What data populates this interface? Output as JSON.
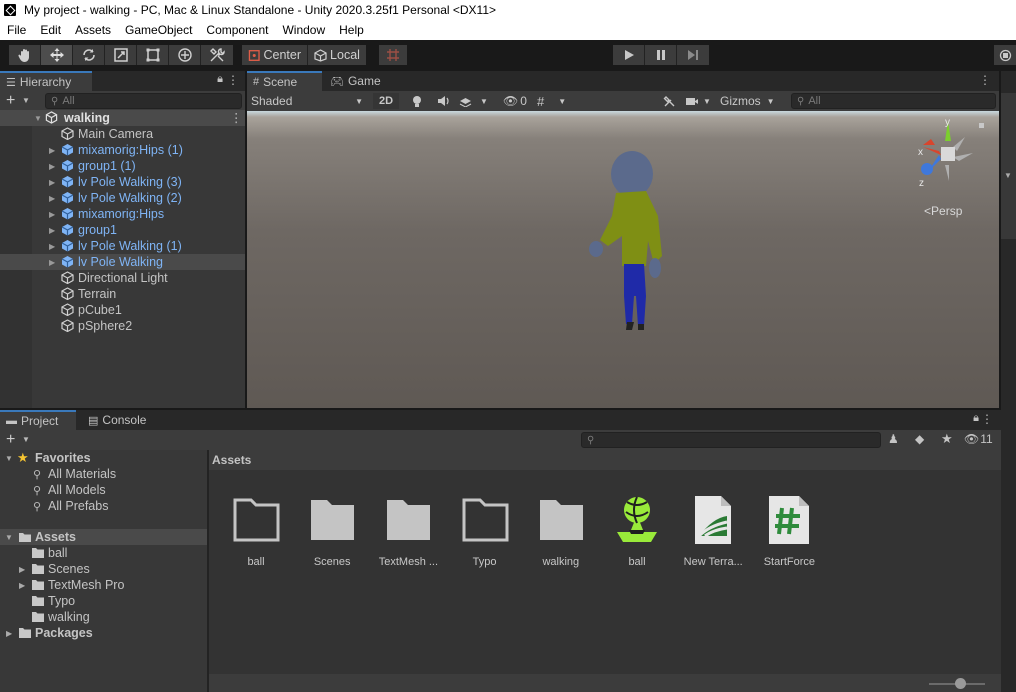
{
  "window": {
    "title": "My project - walking - PC, Mac & Linux Standalone - Unity 2020.3.25f1 Personal <DX11>"
  },
  "menu": [
    "File",
    "Edit",
    "Assets",
    "GameObject",
    "Component",
    "Window",
    "Help"
  ],
  "toolbar": {
    "pivot_label": "Center",
    "space_label": "Local"
  },
  "hierarchy": {
    "tab_label": "Hierarchy",
    "search_placeholder": "All",
    "scene_name": "walking",
    "items": [
      {
        "label": "Main Camera",
        "prefab": false,
        "expandable": false
      },
      {
        "label": "mixamorig:Hips (1)",
        "prefab": true,
        "expandable": true
      },
      {
        "label": "group1 (1)",
        "prefab": true,
        "expandable": true
      },
      {
        "label": "lv Pole Walking (3)",
        "prefab": true,
        "expandable": true
      },
      {
        "label": "lv Pole Walking (2)",
        "prefab": true,
        "expandable": true
      },
      {
        "label": "mixamorig:Hips",
        "prefab": true,
        "expandable": true
      },
      {
        "label": "group1",
        "prefab": true,
        "expandable": true
      },
      {
        "label": "lv Pole Walking (1)",
        "prefab": true,
        "expandable": true
      },
      {
        "label": "lv Pole Walking",
        "prefab": true,
        "expandable": true,
        "selected": true
      },
      {
        "label": "Directional Light",
        "prefab": false,
        "expandable": false
      },
      {
        "label": "Terrain",
        "prefab": false,
        "expandable": false
      },
      {
        "label": "pCube1",
        "prefab": false,
        "expandable": false
      },
      {
        "label": "pSphere2",
        "prefab": false,
        "expandable": false
      }
    ]
  },
  "scene": {
    "tabs": [
      "Scene",
      "Game"
    ],
    "shading_mode": "Shaded",
    "mode_2d": "2D",
    "hidden_count": "0",
    "gizmos_label": "Gizmos",
    "search_placeholder": "All",
    "axis_x": "x",
    "axis_y": "y",
    "axis_z": "z",
    "projection_label": "Persp"
  },
  "project": {
    "tabs": [
      "Project",
      "Console"
    ],
    "hidden_count": "11",
    "favorites_label": "Favorites",
    "favorites": [
      "All Materials",
      "All Models",
      "All Prefabs"
    ],
    "assets_label": "Assets",
    "asset_folders": [
      {
        "label": "ball",
        "expandable": false
      },
      {
        "label": "Scenes",
        "expandable": true
      },
      {
        "label": "TextMesh Pro",
        "expandable": true
      },
      {
        "label": "Typo",
        "expandable": false
      },
      {
        "label": "walking",
        "expandable": false
      }
    ],
    "packages_label": "Packages",
    "breadcrumb": "Assets",
    "grid_items": [
      {
        "label": "ball",
        "kind": "folder-icon"
      },
      {
        "label": "Scenes",
        "kind": "folder-filled-icon"
      },
      {
        "label": "TextMesh ...",
        "kind": "folder-filled-icon"
      },
      {
        "label": "Typo",
        "kind": "folder-icon"
      },
      {
        "label": "walking",
        "kind": "folder-filled-icon"
      },
      {
        "label": "ball",
        "kind": "physic-material-icon"
      },
      {
        "label": "New Terra...",
        "kind": "terrain-data-icon"
      },
      {
        "label": "StartForce",
        "kind": "csharp-script-icon"
      }
    ]
  },
  "colors": {
    "accent_blue": "#3a79bb",
    "prefab_blue": "#7fb4f5",
    "physic_green": "#99ea3a",
    "script_green": "#2f8b3c"
  }
}
